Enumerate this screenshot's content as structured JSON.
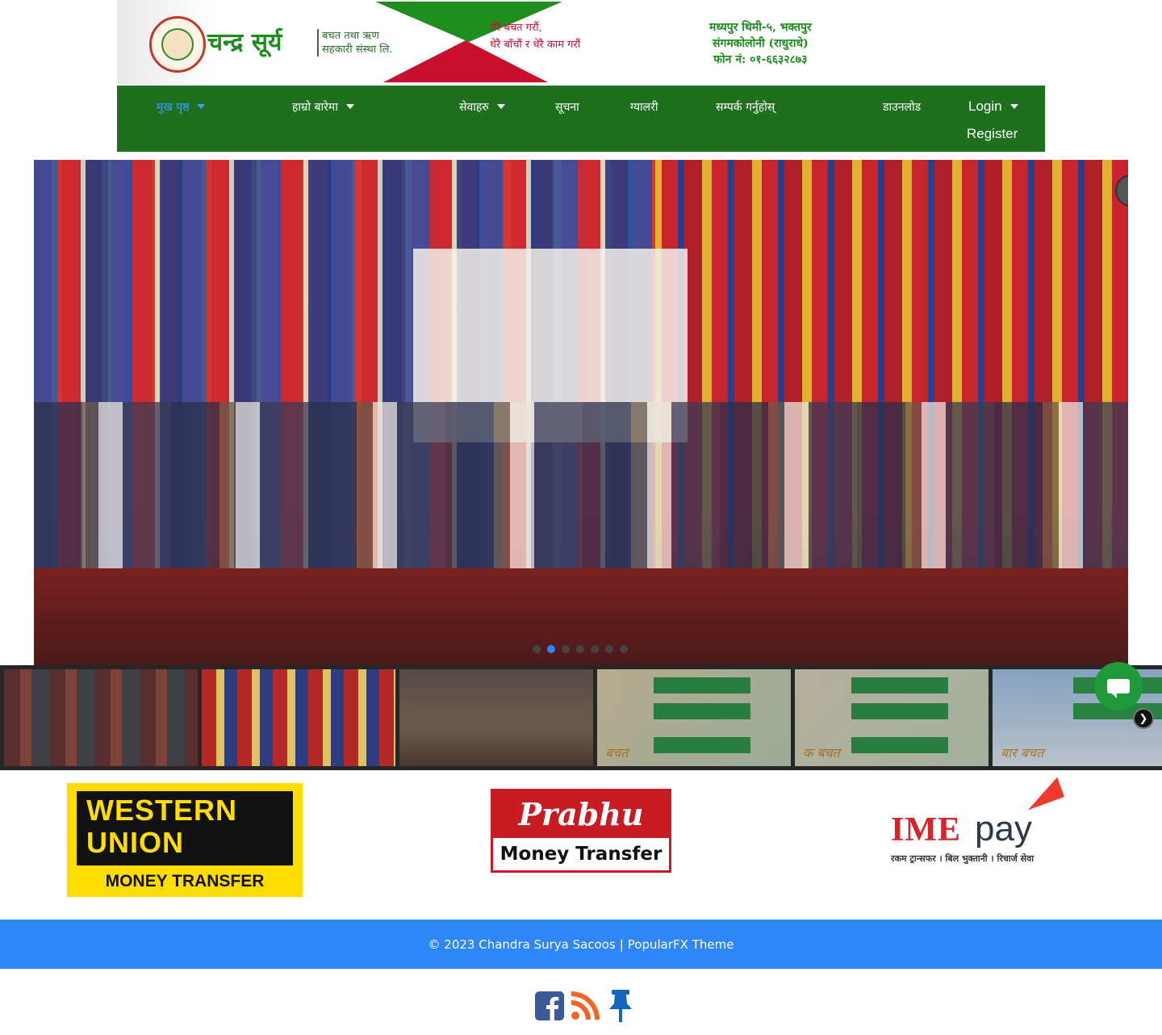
{
  "header": {
    "brand_name": "चन्द्र सूर्य",
    "brand_sub_line1": "बचत तथा ऋण",
    "brand_sub_line2": "सहकारी संस्था लि.",
    "slogan_line1": "धेरै बचत गरौं,",
    "slogan_line2": "धेरै बाँचौं र धेरै काम गरौं",
    "address_line1": "मध्यपुर थिमी-५, भक्तपुर",
    "address_line2": "संगमकोलोनी (राधुराधे)",
    "address_line3": "फोन नं: ०१-६६३२८७३"
  },
  "nav": {
    "items": [
      {
        "label": "मुख पृष्ठ"
      },
      {
        "label": "हाम्रो बारेमा"
      },
      {
        "label": "सेवाहरु"
      },
      {
        "label": "सूचना"
      },
      {
        "label": "ग्यालरी"
      },
      {
        "label": "सम्पर्क गर्नुहोस्"
      },
      {
        "label": "डाउनलोड"
      },
      {
        "label": "Login"
      },
      {
        "label": "Register"
      }
    ]
  },
  "slideshow": {
    "pause_symbol": "II",
    "dot_count": 7,
    "active_dot": 2
  },
  "thumbnails": {
    "words": [
      "बचत",
      "क बचत",
      "बार बचत"
    ]
  },
  "partners": {
    "western_union_line1": "WESTERN",
    "western_union_line2": "UNION",
    "western_union_line3": "MONEY TRANSFER",
    "prabhu_top": "Prabhu",
    "prabhu_bottom": "Money Transfer",
    "ime_brand": "IME",
    "ime_pay": "pay",
    "ime_tagline": "रकम ट्रान्सफर । बिल भुक्तानी । रिचार्ज सेवा"
  },
  "footer": {
    "copyright": "© 2023 Chandra Surya Sacoos",
    "separator": "|",
    "theme_link": "PopularFX Theme"
  },
  "colors": {
    "nav_bg": "#1e6f1e",
    "nav_active": "#3f9dff",
    "footer_bg": "#2f86f6",
    "brand_green": "#1d8d1d",
    "brand_red": "#c8102e",
    "facebook": "#3b5998",
    "rss": "#f26522",
    "pin": "#1565c0"
  },
  "social_icons": [
    "facebook-icon",
    "rss-icon",
    "pin-icon"
  ]
}
